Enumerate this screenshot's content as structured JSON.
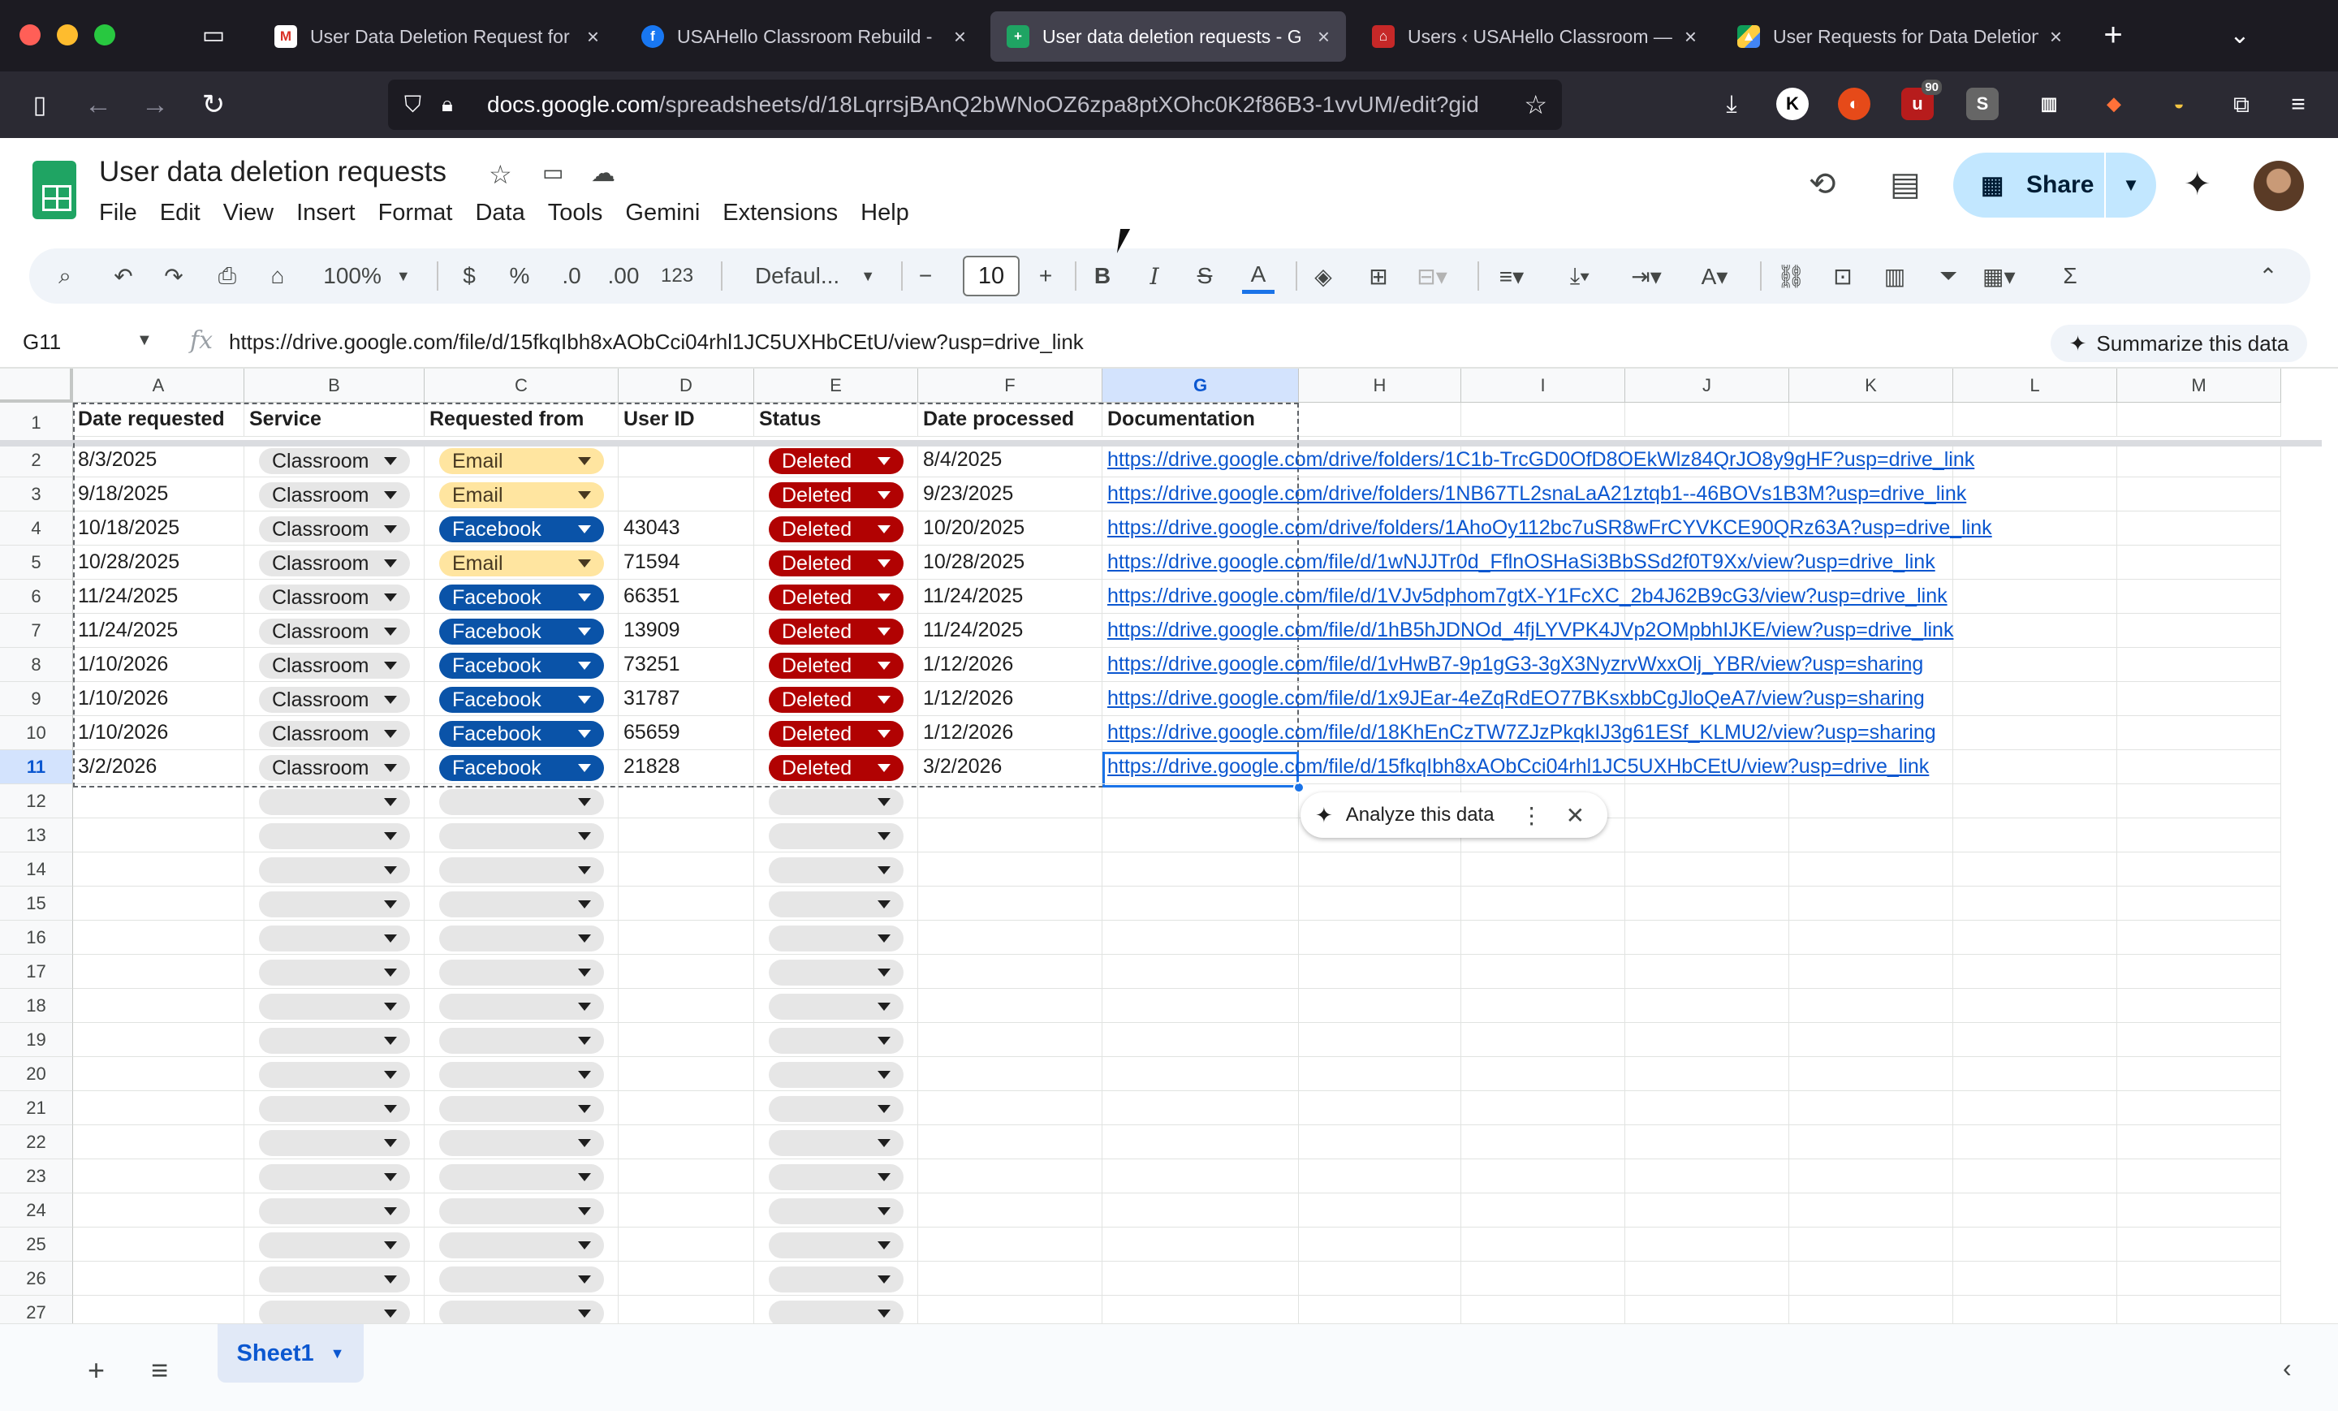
{
  "browser": {
    "tabs": [
      {
        "title": "User Data Deletion Request for",
        "icon": "gmail-icon",
        "active": false
      },
      {
        "title": "USAHello Classroom Rebuild - ",
        "icon": "facebook-icon",
        "active": false
      },
      {
        "title": "User data deletion requests - G",
        "icon": "sheets-icon",
        "active": true
      },
      {
        "title": "Users ‹ USAHello Classroom —",
        "icon": "wordpress-icon",
        "active": false
      },
      {
        "title": "User Requests for Data Deletion",
        "icon": "drive-icon",
        "active": false
      }
    ],
    "url_host": "docs.google.com",
    "url_path": "/spreadsheets/d/18LqrrsjBAnQ2bWNoOZ6zpa8ptXOhc0K2f86B3-1vvUM/edit?gid",
    "badge_count": "90"
  },
  "doc": {
    "title": "User data deletion requests",
    "menu": [
      "File",
      "Edit",
      "View",
      "Insert",
      "Format",
      "Data",
      "Tools",
      "Gemini",
      "Extensions",
      "Help"
    ],
    "share_label": "Share"
  },
  "toolbar": {
    "zoom": "100%",
    "currency": "$",
    "percent": "%",
    "dec_decrease": ".0",
    "dec_increase": ".00",
    "number_format": "123",
    "font": "Defaul...",
    "font_size": "10"
  },
  "formula_bar": {
    "cell_ref": "G11",
    "value": "https://drive.google.com/file/d/15fkqIbh8xAObCci04rhl1JC5UXHbCEtU/view?usp=drive_link",
    "summarize_label": "Summarize this data"
  },
  "columns": [
    "A",
    "B",
    "C",
    "D",
    "E",
    "F",
    "G",
    "H",
    "I",
    "J",
    "K",
    "L",
    "M"
  ],
  "selected_column": "G",
  "selected_row": "11",
  "header_row": [
    "Date requested",
    "Service",
    "Requested from",
    "User ID",
    "Status",
    "Date processed",
    "Documentation"
  ],
  "rows": [
    {
      "date": "8/3/2025",
      "service": "Classroom",
      "from": "Email",
      "uid": "",
      "status": "Deleted",
      "processed": "8/4/2025",
      "doc": "https://drive.google.com/drive/folders/1C1b-TrcGD0OfD8OEkWlz84QrJO8y9gHF?usp=drive_link"
    },
    {
      "date": "9/18/2025",
      "service": "Classroom",
      "from": "Email",
      "uid": "",
      "status": "Deleted",
      "processed": "9/23/2025",
      "doc": "https://drive.google.com/drive/folders/1NB67TL2snaLaA21ztqb1--46BOVs1B3M?usp=drive_link"
    },
    {
      "date": "10/18/2025",
      "service": "Classroom",
      "from": "Facebook",
      "uid": "43043",
      "status": "Deleted",
      "processed": "10/20/2025",
      "doc": "https://drive.google.com/drive/folders/1AhoOy112bc7uSR8wFrCYVKCE90QRz63A?usp=drive_link"
    },
    {
      "date": "10/28/2025",
      "service": "Classroom",
      "from": "Email",
      "uid": "71594",
      "status": "Deleted",
      "processed": "10/28/2025",
      "doc": "https://drive.google.com/file/d/1wNJJTr0d_FflnOSHaSi3BbSSd2f0T9Xx/view?usp=drive_link"
    },
    {
      "date": "11/24/2025",
      "service": "Classroom",
      "from": "Facebook",
      "uid": "66351",
      "status": "Deleted",
      "processed": "11/24/2025",
      "doc": "https://drive.google.com/file/d/1VJv5dphom7gtX-Y1FcXC_2b4J62B9cG3/view?usp=drive_link"
    },
    {
      "date": "11/24/2025",
      "service": "Classroom",
      "from": "Facebook",
      "uid": "13909",
      "status": "Deleted",
      "processed": "11/24/2025",
      "doc": "https://drive.google.com/file/d/1hB5hJDNOd_4fjLYVPK4JVp2OMpbhIJKE/view?usp=drive_link"
    },
    {
      "date": "1/10/2026",
      "service": "Classroom",
      "from": "Facebook",
      "uid": "73251",
      "status": "Deleted",
      "processed": "1/12/2026",
      "doc": "https://drive.google.com/file/d/1vHwB7-9p1gG3-3gX3NyzrvWxxOlj_YBR/view?usp=sharing"
    },
    {
      "date": "1/10/2026",
      "service": "Classroom",
      "from": "Facebook",
      "uid": "31787",
      "status": "Deleted",
      "processed": "1/12/2026",
      "doc": "https://drive.google.com/file/d/1x9JEar-4eZqRdEO77BKsxbbCgJloQeA7/view?usp=sharing"
    },
    {
      "date": "1/10/2026",
      "service": "Classroom",
      "from": "Facebook",
      "uid": "65659",
      "status": "Deleted",
      "processed": "1/12/2026",
      "doc": "https://drive.google.com/file/d/18KhEnCzTW7ZJzPkqkIJ3g61ESf_KLMU2/view?usp=sharing"
    },
    {
      "date": "3/2/2026",
      "service": "Classroom",
      "from": "Facebook",
      "uid": "21828",
      "status": "Deleted",
      "processed": "3/2/2026",
      "doc": "https://drive.google.com/file/d/15fkqIbh8xAObCci04rhl1JC5UXHbCEtU/view?usp=drive_link"
    }
  ],
  "row_numbers": [
    "1",
    "2",
    "3",
    "4",
    "5",
    "6",
    "7",
    "8",
    "9",
    "10",
    "11",
    "12",
    "13",
    "14",
    "15",
    "16",
    "17",
    "18",
    "19",
    "20",
    "21",
    "22",
    "23",
    "24",
    "25",
    "26",
    "27"
  ],
  "analyze_label": "Analyze this data",
  "sheet_tab": "Sheet1",
  "colors": {
    "classroom_chip": "#e6e6e6",
    "email_chip": "#ffe5a0",
    "facebook_chip": "#0a53a8",
    "deleted_chip": "#b10202",
    "link": "#0b57d0",
    "selection": "#1a73e8"
  }
}
